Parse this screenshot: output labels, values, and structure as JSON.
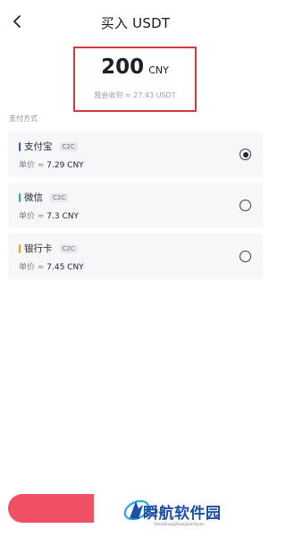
{
  "header": {
    "title": "买入 USDT",
    "back_icon": "chevron-left-icon"
  },
  "amount": {
    "value": "200",
    "unit": "CNY",
    "receive_text": "我会收到 ≈ 27.43 USDT"
  },
  "payment": {
    "section_label": "支付方式",
    "methods": [
      {
        "name": "支付宝",
        "tag": "C2C",
        "price_label": "单价 ≈ ",
        "price_value": "7.29 CNY",
        "accent_color": "#2a5bd7",
        "selected": true
      },
      {
        "name": "微信",
        "tag": "C2C",
        "price_label": "单价 ≈ ",
        "price_value": "7.3 CNY",
        "accent_color": "#22b573",
        "selected": false
      },
      {
        "name": "银行卡",
        "tag": "C2C",
        "price_label": "单价 ≈ ",
        "price_value": "7.45 CNY",
        "accent_color": "#f39c24",
        "selected": false
      }
    ]
  },
  "buy_button": {
    "color": "#ef5163"
  },
  "watermark": {
    "title": "瞬航软件园",
    "subtitle": "ShunHangRuanJianYuan"
  },
  "colors": {
    "highlight_border": "#d13a3a",
    "card_bg": "#f6f7f9"
  }
}
